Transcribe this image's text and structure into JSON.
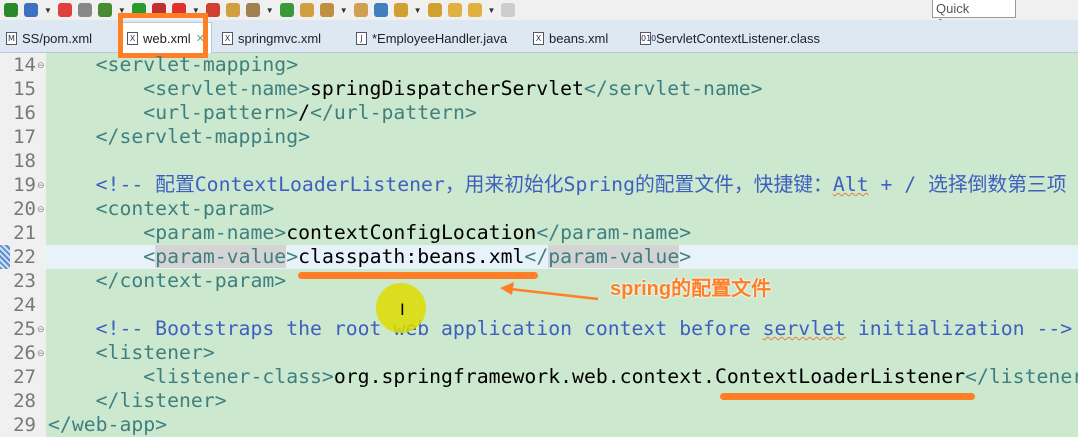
{
  "toolbar": {
    "quick_access": "Quick Access",
    "icons": [
      "spring-boot-icon",
      "task-icon",
      "sync-icon",
      "debug-icon",
      "bug-icon",
      "run-icon",
      "stop-server-icon",
      "stop-icon",
      "run-external-icon",
      "new-package-icon",
      "new-class-icon",
      "refresh-icon",
      "open-folder-icon",
      "open-type-icon",
      "search-icon",
      "globe-icon",
      "next-annotation-icon",
      "prev-annotation-icon",
      "last-edit-icon",
      "back-icon",
      "forward-icon"
    ]
  },
  "tabs": [
    {
      "label": "SS/pom.xml",
      "icon": "M"
    },
    {
      "label": "web.xml",
      "icon": "X",
      "active": true
    },
    {
      "label": "springmvc.xml",
      "icon": "X"
    },
    {
      "label": "*EmployeeHandler.java",
      "icon": "J"
    },
    {
      "label": "beans.xml",
      "icon": "X"
    },
    {
      "label": "ServletContextListener.class",
      "icon": "010"
    }
  ],
  "editor": {
    "current_line": 22,
    "lines": [
      {
        "n": "14",
        "fold": true,
        "indent": 1,
        "tokens": [
          [
            "t",
            "<servlet-mapping>"
          ]
        ]
      },
      {
        "n": "15",
        "indent": 2,
        "tokens": [
          [
            "t",
            "<servlet-name>"
          ],
          [
            "x",
            "springDispatcherServlet"
          ],
          [
            "t",
            "</servlet-name>"
          ]
        ]
      },
      {
        "n": "16",
        "indent": 2,
        "tokens": [
          [
            "t",
            "<url-pattern>"
          ],
          [
            "x",
            "/"
          ],
          [
            "t",
            "</url-pattern>"
          ]
        ]
      },
      {
        "n": "17",
        "indent": 1,
        "tokens": [
          [
            "t",
            "</servlet-mapping>"
          ]
        ]
      },
      {
        "n": "18",
        "indent": 0,
        "tokens": []
      },
      {
        "n": "19",
        "fold": true,
        "indent": 1,
        "tokens": [
          [
            "c",
            "<!-- 配置ContextLoaderListener，用来初始化Spring的配置文件，快捷键："
          ],
          [
            "cs",
            "Alt"
          ],
          [
            "c",
            " + / 选择倒数第三项 -->"
          ]
        ]
      },
      {
        "n": "20",
        "fold": true,
        "indent": 1,
        "tokens": [
          [
            "t",
            "<context-param>"
          ]
        ]
      },
      {
        "n": "21",
        "indent": 2,
        "tokens": [
          [
            "t",
            "<param-name>"
          ],
          [
            "x",
            "contextConfigLocation"
          ],
          [
            "t",
            "</param-name>"
          ]
        ]
      },
      {
        "n": "22",
        "indent": 2,
        "tokens": [
          [
            "t",
            "<"
          ],
          [
            "ts",
            "param-value"
          ],
          [
            "t",
            ">"
          ],
          [
            "x",
            "classpath:beans.xml"
          ],
          [
            "t",
            "</"
          ],
          [
            "ts",
            "param-value"
          ],
          [
            "t",
            ">"
          ]
        ]
      },
      {
        "n": "23",
        "indent": 1,
        "tokens": [
          [
            "t",
            "</context-param>"
          ]
        ]
      },
      {
        "n": "24",
        "indent": 0,
        "tokens": []
      },
      {
        "n": "25",
        "fold": true,
        "indent": 1,
        "tokens": [
          [
            "c",
            "<!-- Bootstraps the root web application context before "
          ],
          [
            "cs",
            "servlet"
          ],
          [
            "c",
            " initialization -->"
          ]
        ]
      },
      {
        "n": "26",
        "fold": true,
        "indent": 1,
        "tokens": [
          [
            "t",
            "<listener>"
          ]
        ]
      },
      {
        "n": "27",
        "indent": 2,
        "tokens": [
          [
            "t",
            "<listener-class>"
          ],
          [
            "x",
            "org.springframework.web.context.ContextLoaderListener"
          ],
          [
            "t",
            "</listener-class>"
          ]
        ]
      },
      {
        "n": "28",
        "indent": 1,
        "tokens": [
          [
            "t",
            "</listener>"
          ]
        ]
      },
      {
        "n": "29",
        "indent": 0,
        "tokens": [
          [
            "t",
            "</web-app>"
          ]
        ]
      }
    ]
  },
  "annotation": {
    "note": "spring的配置文件",
    "color": "#ff7f27"
  },
  "colors": {
    "background": "#cce8cf",
    "tag": "#3f7f7f",
    "comment": "#3f5fbf",
    "accent": "#ff7f27"
  }
}
